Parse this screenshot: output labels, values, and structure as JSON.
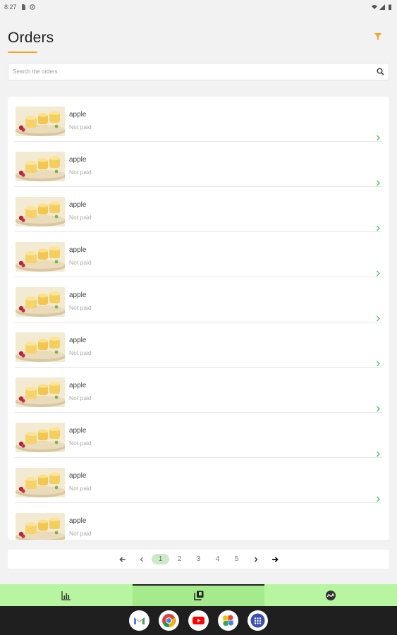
{
  "status_bar": {
    "time": "8:27"
  },
  "header": {
    "title": "Orders"
  },
  "search": {
    "placeholder": "Search the orders"
  },
  "orders": [
    {
      "name": "apple",
      "status": "Not paid"
    },
    {
      "name": "apple",
      "status": "Not paid"
    },
    {
      "name": "apple",
      "status": "Not paid"
    },
    {
      "name": "apple",
      "status": "Not paid"
    },
    {
      "name": "apple",
      "status": "Not paid"
    },
    {
      "name": "apple",
      "status": "Not paid"
    },
    {
      "name": "apple",
      "status": "Not paid"
    },
    {
      "name": "apple",
      "status": "Not paid"
    },
    {
      "name": "apple",
      "status": "Not paid"
    },
    {
      "name": "apple",
      "status": "Not paid"
    }
  ],
  "pagination": {
    "pages": [
      "1",
      "2",
      "3",
      "4",
      "5"
    ],
    "current": "1"
  },
  "bottom_nav": {
    "tabs": [
      "chart-icon",
      "orders-icon",
      "profile-icon"
    ],
    "active_tab": "orders-icon"
  },
  "dock": {
    "apps": [
      "gmail-icon",
      "chrome-icon",
      "youtube-icon",
      "photos-icon",
      "app-drawer-icon"
    ]
  },
  "colors": {
    "accent": "#f5a623",
    "nav_bg": "#b8f5a0",
    "page_active": "#cfe8c9",
    "chevron": "#5cc06a"
  }
}
